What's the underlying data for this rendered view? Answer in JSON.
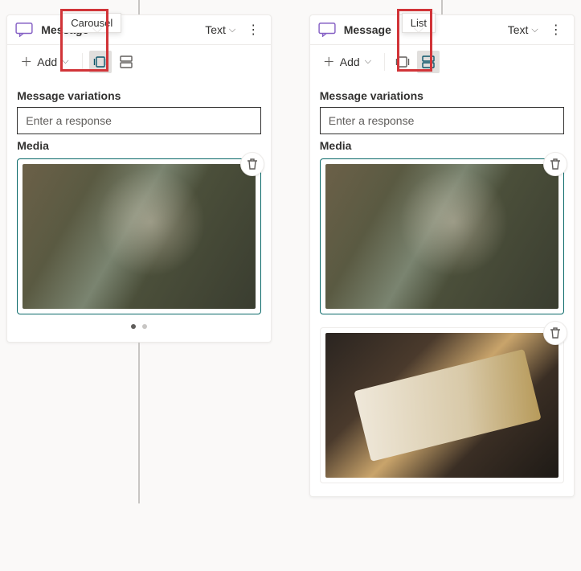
{
  "left": {
    "tooltip": "Carousel",
    "title": "Message",
    "type_label": "Text",
    "add_label": "Add",
    "section_variations": "Message variations",
    "response_placeholder": "Enter a response",
    "section_media": "Media"
  },
  "right": {
    "tooltip": "List",
    "title": "Message",
    "type_label": "Text",
    "add_label": "Add",
    "section_variations": "Message variations",
    "response_placeholder": "Enter a response",
    "section_media": "Media"
  }
}
